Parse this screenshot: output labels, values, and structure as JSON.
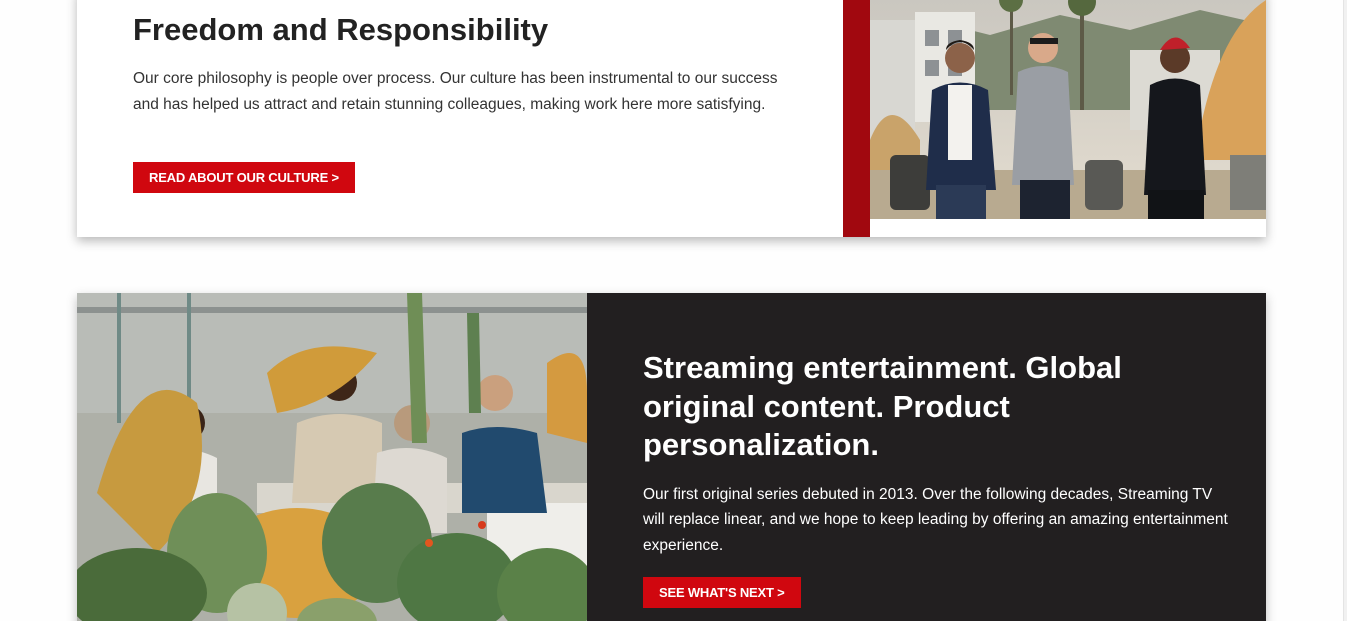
{
  "culture": {
    "title": "Freedom and Responsibility",
    "body": "Our core philosophy is people over process. Our culture has been instrumental to our success and has helped us attract and retain stunning colleagues, making work here more satisfying.",
    "button_label": "READ ABOUT OUR CULTURE >",
    "photo": "three colleagues walking on a rooftop"
  },
  "streaming": {
    "title": "Streaming entertainment. Global original content. Product personalization.",
    "body": "Our first original series debuted in 2013. Over the following decades, Streaming TV will replace linear, and we hope to keep leading by offering an amazing entertainment experience.",
    "button_label": "SEE WHAT'S NEXT >",
    "photo": "colleagues talking at a rooftop table among succulent plants"
  },
  "colors": {
    "accent_red": "#d0070f",
    "dark_red_bar": "#a1080f",
    "dark_card": "#221f20"
  }
}
